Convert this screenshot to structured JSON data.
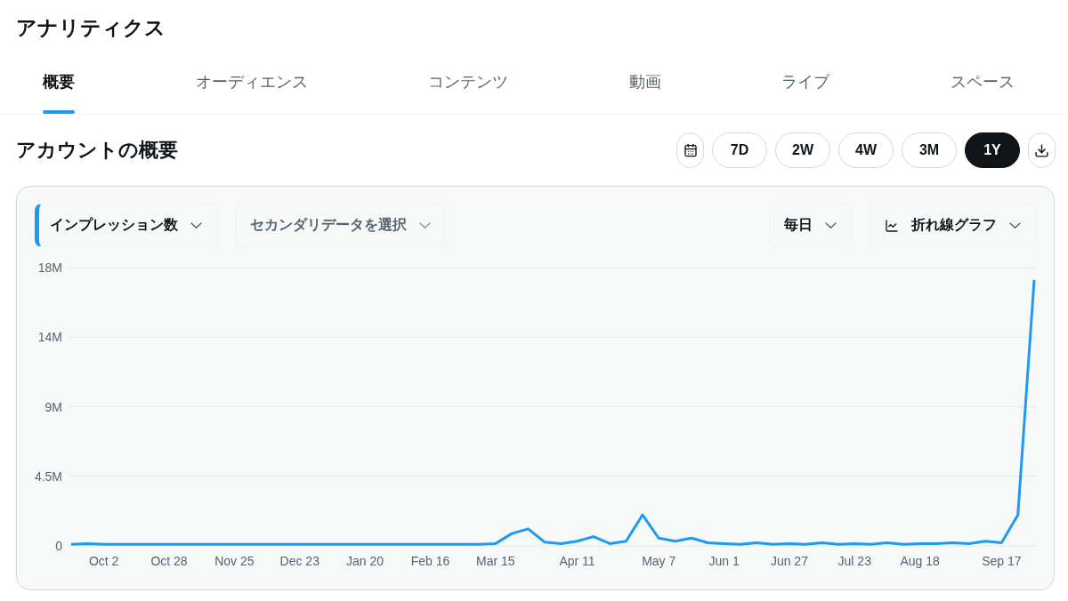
{
  "page_title": "アナリティクス",
  "tabs": [
    {
      "label": "概要",
      "selected": true
    },
    {
      "label": "オーディエンス",
      "selected": false
    },
    {
      "label": "コンテンツ",
      "selected": false
    },
    {
      "label": "動画",
      "selected": false
    },
    {
      "label": "ライブ",
      "selected": false
    },
    {
      "label": "スペース",
      "selected": false
    }
  ],
  "section_title": "アカウントの概要",
  "ranges": [
    {
      "label": "7D",
      "selected": false
    },
    {
      "label": "2W",
      "selected": false
    },
    {
      "label": "4W",
      "selected": false
    },
    {
      "label": "3M",
      "selected": false
    },
    {
      "label": "1Y",
      "selected": true
    }
  ],
  "controls": {
    "primary_metric": {
      "value": "インプレッション数"
    },
    "secondary_metric": {
      "placeholder": "セカンダリデータを選択"
    },
    "interval": {
      "value": "毎日"
    },
    "chart_type": {
      "value": "折れ線グラフ"
    }
  },
  "chart_data": {
    "type": "line",
    "categories": [
      null,
      null,
      "Oct 2",
      null,
      null,
      null,
      "Oct 28",
      null,
      null,
      null,
      "Nov 25",
      null,
      null,
      null,
      "Dec 23",
      null,
      null,
      null,
      "Jan 20",
      null,
      null,
      null,
      "Feb 16",
      null,
      null,
      null,
      "Mar 15",
      null,
      null,
      null,
      null,
      "Apr 11",
      null,
      null,
      null,
      null,
      "May 7",
      null,
      null,
      null,
      "Jun 1",
      null,
      null,
      null,
      "Jun 27",
      null,
      null,
      null,
      "Jul 23",
      null,
      null,
      null,
      "Aug 18",
      null,
      null,
      null,
      null,
      "Sep 17",
      null,
      null
    ],
    "grid": true,
    "series": [
      {
        "color": "#1d9bf0",
        "values": [
          100000,
          150000,
          100000,
          100000,
          100000,
          100000,
          100000,
          100000,
          100000,
          100000,
          100000,
          100000,
          100000,
          100000,
          100000,
          100000,
          100000,
          100000,
          100000,
          100000,
          100000,
          100000,
          100000,
          100000,
          100000,
          100000,
          150000,
          800000,
          1100000,
          250000,
          150000,
          300000,
          600000,
          150000,
          300000,
          2000000,
          500000,
          300000,
          500000,
          200000,
          150000,
          100000,
          200000,
          100000,
          150000,
          100000,
          200000,
          100000,
          150000,
          100000,
          200000,
          100000,
          150000,
          150000,
          200000,
          150000,
          300000,
          200000,
          2000000,
          17200000
        ]
      }
    ],
    "ylim": [
      0,
      18000000
    ],
    "yticks": [
      {
        "value": 0,
        "label": "0"
      },
      {
        "value": 4500000,
        "label": "4.5M"
      },
      {
        "value": 9000000,
        "label": "9M"
      },
      {
        "value": 13500000,
        "label": "14M"
      },
      {
        "value": 18000000,
        "label": "18M"
      }
    ]
  }
}
